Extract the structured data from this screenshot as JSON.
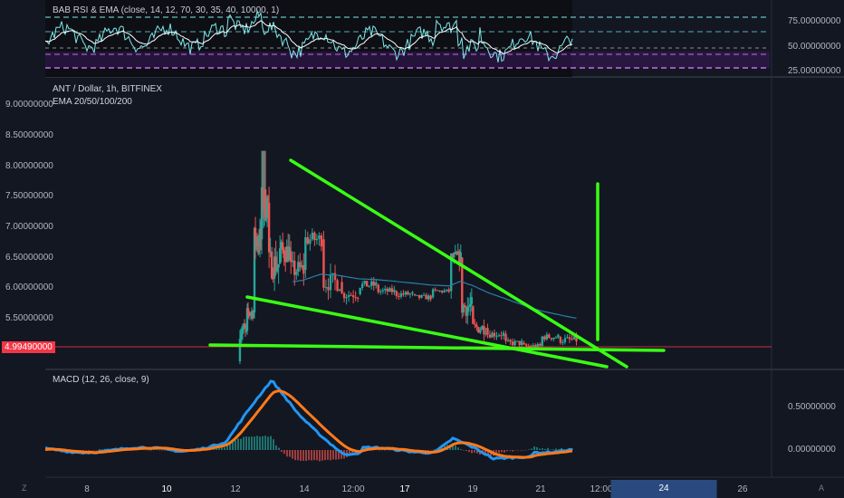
{
  "title": {
    "pair": "ANT / Dollar, 1h, BITFINEX",
    "ema": "EMA 20/50/100/200",
    "rsi": "BAB RSI & EMA (close, 14, 12, 70, 30, 35, 40, 10000, 1)",
    "macd": "MACD (12, 26, close, 9)"
  },
  "colors": {
    "background": "#131722",
    "up": "#26a69a",
    "down": "#ef5350",
    "trendline": "#39ff14",
    "rsi_line": "#7ee8e8",
    "rsi_ema": "#ffffff",
    "macd": "#2196f3",
    "signal": "#ff7a1a",
    "price_line": "#f23645",
    "ema_line": "#2a7fa8",
    "rsi_band": "#7b2cbf"
  },
  "price_axis": {
    "ticks": [
      "9.00000000",
      "8.50000000",
      "8.00000000",
      "7.50000000",
      "7.00000000",
      "6.50000000",
      "6.00000000",
      "5.50000000"
    ],
    "current": "4.99490000"
  },
  "rsi_axis": {
    "ticks": [
      "75.00000000",
      "50.00000000",
      "25.00000000"
    ]
  },
  "macd_axis": {
    "ticks": [
      "0.50000000",
      "0.00000000"
    ]
  },
  "time_axis": {
    "ticks": [
      "8",
      "10",
      "12",
      "14",
      "12:00",
      "17",
      "19",
      "21",
      "12:00",
      "24",
      "26"
    ],
    "highlighted": "24"
  },
  "corner_left": "Z",
  "corner_right": "A",
  "chart_data": {
    "type": "candlestick",
    "title": "ANT / Dollar, 1h, BITFINEX",
    "ylim": [
      4.7,
      9.3
    ],
    "price_series_approx": [
      {
        "t": 12.2,
        "o": 4.8,
        "h": 5.5,
        "l": 4.75,
        "c": 5.3
      },
      {
        "t": 12.4,
        "o": 5.3,
        "h": 5.7,
        "l": 5.2,
        "c": 5.6
      },
      {
        "t": 12.6,
        "o": 5.6,
        "h": 6.9,
        "l": 5.6,
        "c": 6.8
      },
      {
        "t": 12.8,
        "o": 6.8,
        "h": 8.25,
        "l": 6.6,
        "c": 7.4
      },
      {
        "t": 13.0,
        "o": 7.4,
        "h": 7.6,
        "l": 6.2,
        "c": 6.4
      },
      {
        "t": 13.3,
        "o": 6.4,
        "h": 7.1,
        "l": 6.0,
        "c": 6.6
      },
      {
        "t": 13.6,
        "o": 6.6,
        "h": 7.05,
        "l": 6.1,
        "c": 6.3
      },
      {
        "t": 14.0,
        "o": 6.3,
        "h": 7.0,
        "l": 6.3,
        "c": 6.8
      },
      {
        "t": 14.5,
        "o": 6.8,
        "h": 6.9,
        "l": 6.0,
        "c": 6.1
      },
      {
        "t": 15.0,
        "o": 6.1,
        "h": 6.2,
        "l": 5.7,
        "c": 5.9
      },
      {
        "t": 15.5,
        "o": 5.9,
        "h": 6.2,
        "l": 5.8,
        "c": 6.05
      },
      {
        "t": 16.0,
        "o": 6.05,
        "h": 6.15,
        "l": 5.85,
        "c": 5.95
      },
      {
        "t": 16.5,
        "o": 5.95,
        "h": 6.1,
        "l": 5.8,
        "c": 5.9
      },
      {
        "t": 17.0,
        "o": 5.9,
        "h": 6.0,
        "l": 5.75,
        "c": 5.85
      },
      {
        "t": 17.5,
        "o": 5.85,
        "h": 6.0,
        "l": 5.8,
        "c": 5.95
      },
      {
        "t": 18.0,
        "o": 5.95,
        "h": 6.55,
        "l": 5.9,
        "c": 6.5
      },
      {
        "t": 18.3,
        "o": 6.5,
        "h": 6.55,
        "l": 5.6,
        "c": 5.7
      },
      {
        "t": 18.6,
        "o": 5.7,
        "h": 5.8,
        "l": 5.2,
        "c": 5.35
      },
      {
        "t": 19.0,
        "o": 5.35,
        "h": 5.5,
        "l": 5.15,
        "c": 5.25
      },
      {
        "t": 19.5,
        "o": 5.25,
        "h": 5.35,
        "l": 5.05,
        "c": 5.1
      },
      {
        "t": 20.0,
        "o": 5.1,
        "h": 5.2,
        "l": 4.98,
        "c": 5.05
      },
      {
        "t": 20.5,
        "o": 5.05,
        "h": 5.3,
        "l": 5.0,
        "c": 5.2
      },
      {
        "t": 21.0,
        "o": 5.2,
        "h": 5.45,
        "l": 5.1,
        "c": 5.15
      },
      {
        "t": 21.5,
        "o": 5.15,
        "h": 5.2,
        "l": 4.97,
        "c": 4.99
      }
    ],
    "current_price": 4.9949,
    "rsi_levels": [
      75,
      50,
      25
    ],
    "macd_levels": [
      0.5,
      0.0
    ]
  }
}
